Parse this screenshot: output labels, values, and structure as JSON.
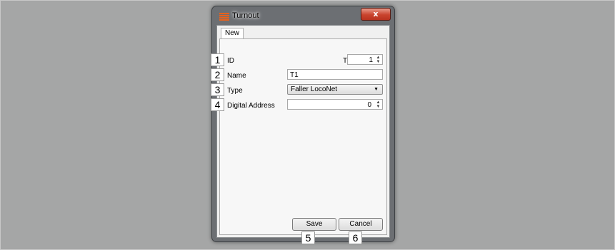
{
  "window": {
    "title": "Turnout",
    "close_glyph": "x"
  },
  "tabs": [
    {
      "label": "New"
    }
  ],
  "form": {
    "id": {
      "label": "ID",
      "prefix": "T",
      "value": "1"
    },
    "name": {
      "label": "Name",
      "value": "T1"
    },
    "type": {
      "label": "Type",
      "value": "Faller LocoNet"
    },
    "address": {
      "label": "Digital Address",
      "value": "0"
    }
  },
  "buttons": {
    "save": "Save",
    "cancel": "Cancel"
  },
  "callouts": [
    "1",
    "2",
    "3",
    "4",
    "5",
    "6"
  ],
  "icons": {
    "title": "turnout-menu-icon",
    "close": "close-icon",
    "spin": "spin-arrows-icon",
    "dropdown": "dropdown-arrow-icon"
  },
  "colors": {
    "desktop": "#a5a6a6",
    "window_frame": "#6c6f73",
    "close_button": "#c9442e",
    "title_icon": "#e8621c"
  }
}
